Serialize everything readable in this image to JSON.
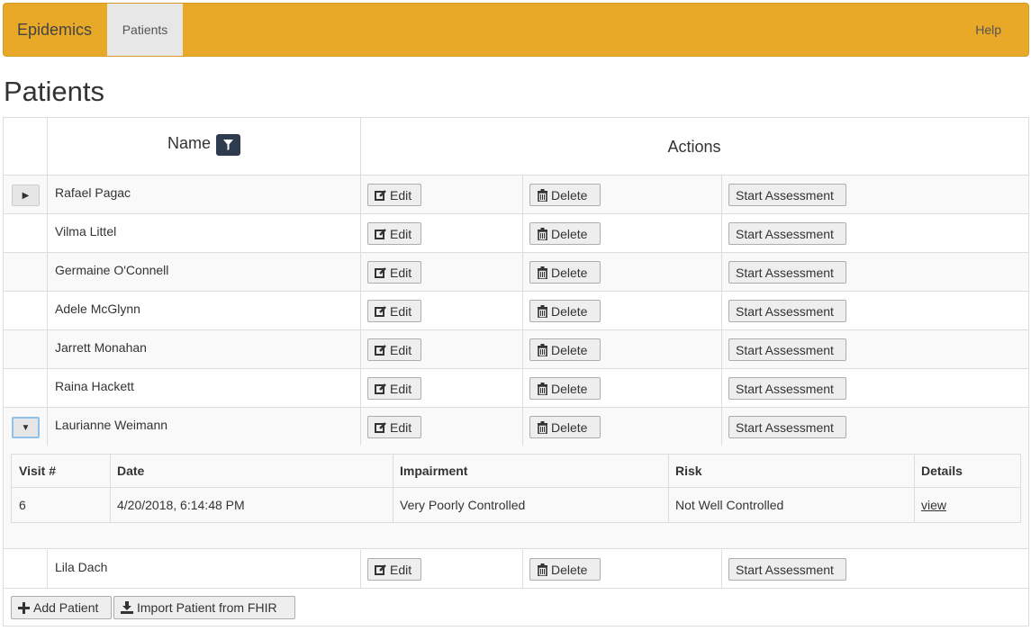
{
  "navbar": {
    "brand": "Epidemics",
    "tab_patients": "Patients",
    "help": "Help"
  },
  "page": {
    "title": "Patients"
  },
  "table": {
    "header_name": "Name",
    "header_actions": "Actions",
    "edit_label": "Edit",
    "delete_label": "Delete",
    "assess_label": "Start Assessment",
    "rows": [
      {
        "name": "Rafael Pagac"
      },
      {
        "name": "Vilma Littel"
      },
      {
        "name": "Germaine O'Connell"
      },
      {
        "name": "Adele McGlynn"
      },
      {
        "name": "Jarrett Monahan"
      },
      {
        "name": "Raina Hackett"
      },
      {
        "name": "Laurianne Weimann"
      },
      {
        "name": "Lila Dach"
      }
    ]
  },
  "visits": {
    "headers": {
      "visit": "Visit #",
      "date": "Date",
      "impairment": "Impairment",
      "risk": "Risk",
      "details": "Details"
    },
    "rows": [
      {
        "visit": "6",
        "date": "4/20/2018, 6:14:48 PM",
        "impairment": "Very Poorly Controlled",
        "risk": "Not Well Controlled",
        "details": "view"
      }
    ]
  },
  "footer": {
    "add_label": "Add Patient",
    "import_label": "Import Patient from FHIR"
  },
  "colors": {
    "navbar": "#e8a828",
    "filter_icon": "#2e3b4e"
  }
}
